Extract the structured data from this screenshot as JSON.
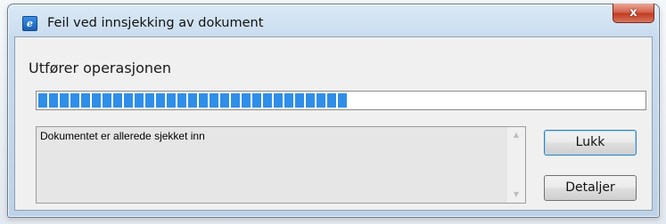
{
  "window": {
    "title": "Feil ved innsjekking av dokument",
    "close_label": "x"
  },
  "dialog": {
    "status_label": "Utfører operasjonen",
    "progress_fraction": 0.51,
    "message": "Dokumentet er allerede sjekket inn",
    "buttons": {
      "close": "Lukk",
      "details": "Detaljer"
    }
  },
  "icons": {
    "app": "app-icon",
    "scroll_up": "scroll-up-arrow-icon",
    "scroll_down": "scroll-down-arrow-icon"
  },
  "colors": {
    "progress": "#2f8ee8",
    "close_button": "#c23c22"
  }
}
